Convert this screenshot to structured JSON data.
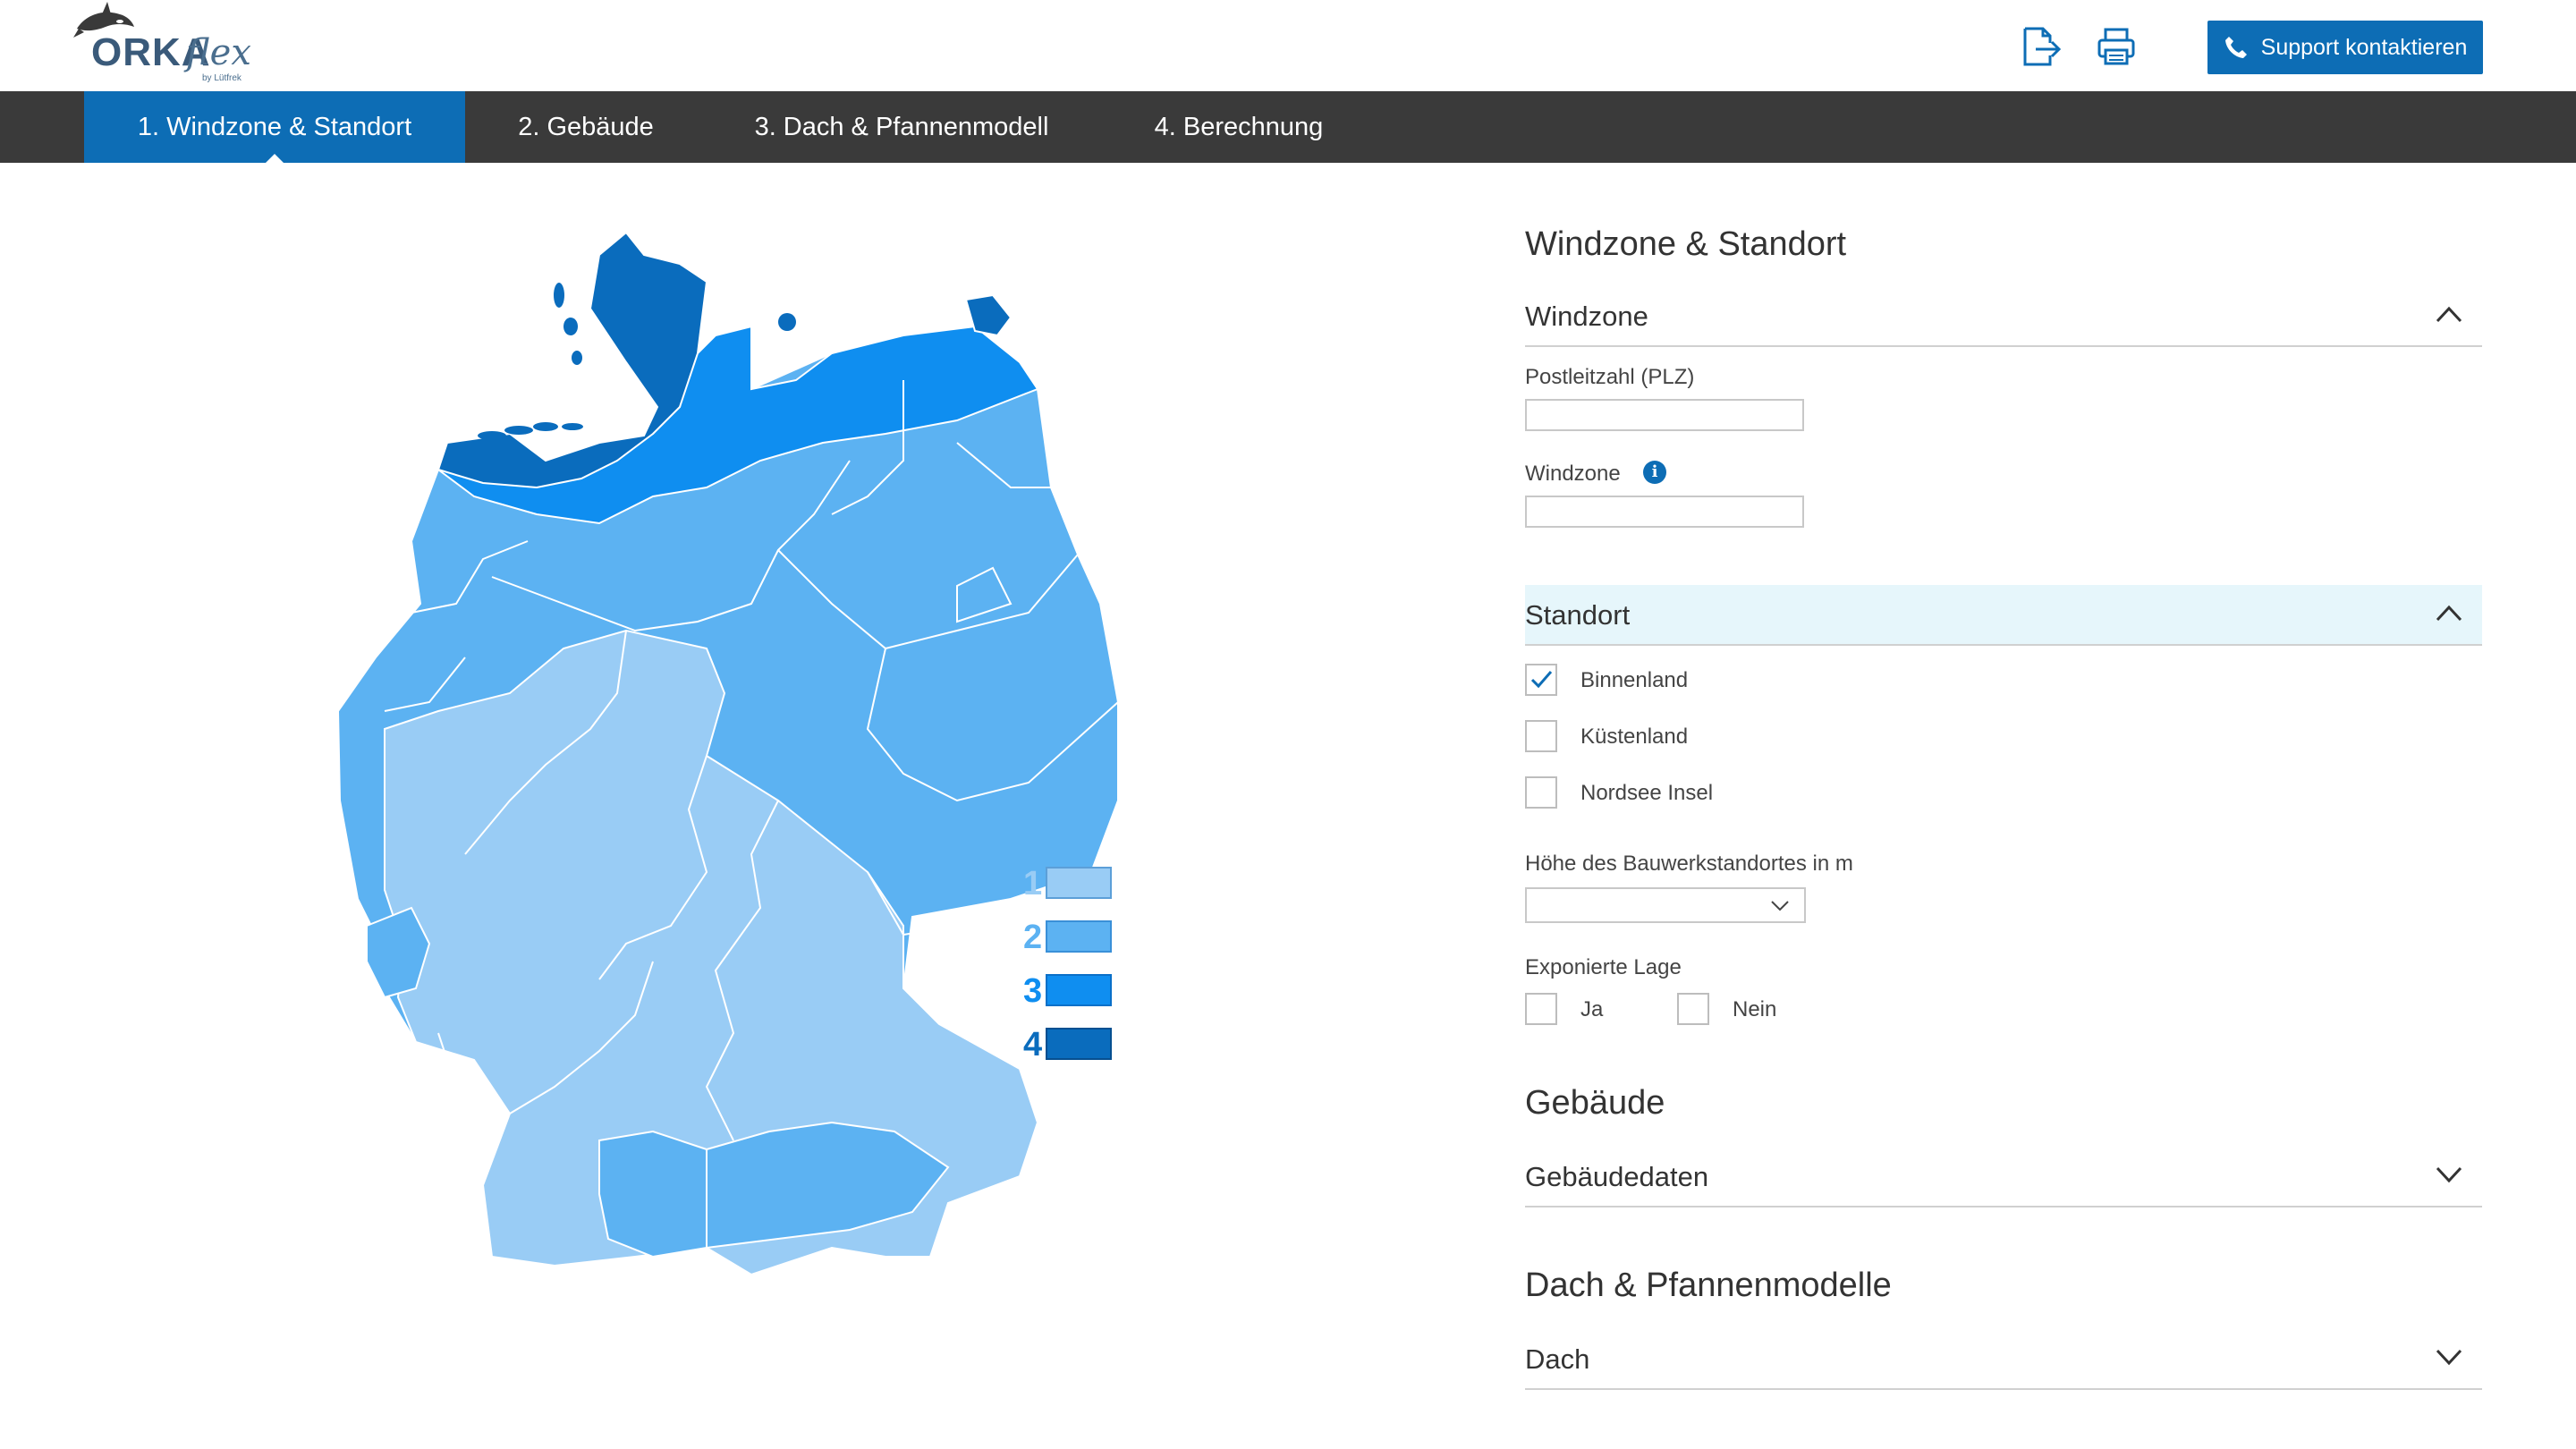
{
  "header": {
    "logo_text": "ORKA",
    "logo_script": "flex",
    "logo_sub": "by Lütfrek",
    "support_label": "Support kontaktieren",
    "colors": {
      "primary": "#0d6db5",
      "nav_bg": "#3a3a3a"
    }
  },
  "nav": {
    "tabs": [
      {
        "label": "1. Windzone & Standort",
        "active": true
      },
      {
        "label": "2. Gebäude",
        "active": false
      },
      {
        "label": "3. Dach & Pfannenmodell",
        "active": false
      },
      {
        "label": "4. Berechnung",
        "active": false
      }
    ]
  },
  "map": {
    "legend": [
      {
        "label": "1",
        "color": "#99ccf5"
      },
      {
        "label": "2",
        "color": "#5cb2f2"
      },
      {
        "label": "3",
        "color": "#0f8ef0"
      },
      {
        "label": "4",
        "color": "#0a6cbd"
      }
    ]
  },
  "panel": {
    "title": "Windzone & Standort",
    "windzone_section": {
      "title": "Windzone",
      "plz_label": "Postleitzahl (PLZ)",
      "plz_value": "",
      "windzone_label": "Windzone",
      "windzone_value": ""
    },
    "standort_section": {
      "title": "Standort",
      "options": [
        {
          "label": "Binnenland",
          "checked": true
        },
        {
          "label": "Küstenland",
          "checked": false
        },
        {
          "label": "Nordsee Insel",
          "checked": false
        }
      ],
      "height_label": "Höhe des Bauwerkstandortes in m",
      "height_value": "",
      "exposed_label": "Exponierte Lage",
      "exposed_yes": "Ja",
      "exposed_no": "Nein"
    },
    "gebaeude": {
      "title": "Gebäude",
      "section": "Gebäudedaten"
    },
    "dach": {
      "title": "Dach & Pfannenmodelle",
      "section": "Dach"
    }
  }
}
